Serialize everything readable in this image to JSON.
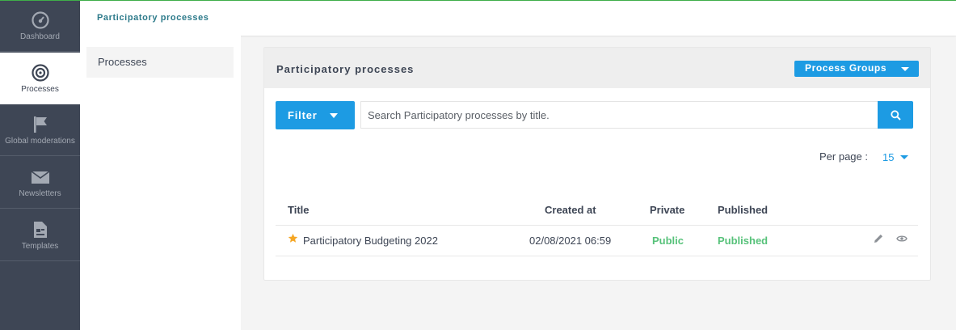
{
  "sidebar": {
    "items": [
      {
        "label": "Dashboard",
        "icon": "dashboard-icon"
      },
      {
        "label": "Processes",
        "icon": "target-icon",
        "active": true
      },
      {
        "label": "Global moderations",
        "icon": "flag-icon"
      },
      {
        "label": "Newsletters",
        "icon": "envelope-icon"
      },
      {
        "label": "Templates",
        "icon": "template-icon"
      }
    ]
  },
  "header": {
    "title": "Participatory processes"
  },
  "subnav": {
    "items": [
      {
        "label": "Processes"
      }
    ]
  },
  "card": {
    "title": "Participatory processes",
    "process_groups_label": "Process Groups",
    "filter_label": "Filter",
    "search_placeholder": "Search Participatory processes by title.",
    "per_page_label": "Per page :",
    "per_page_value": "15",
    "table": {
      "columns": [
        "Title",
        "Created at",
        "Private",
        "Published"
      ],
      "rows": [
        {
          "title": "Participatory Budgeting 2022",
          "created_at": "02/08/2021 06:59",
          "private": "Public",
          "published": "Published",
          "promoted": true
        }
      ]
    }
  },
  "colors": {
    "sidebar_bg": "#3e4655",
    "accent": "#1d9be3",
    "status_green": "#57c27a",
    "star": "#f5a623",
    "header_title": "#2c7a8a"
  },
  "icons": {
    "search": "search-icon",
    "star": "star-icon",
    "edit": "pencil-icon",
    "preview": "eye-icon"
  }
}
